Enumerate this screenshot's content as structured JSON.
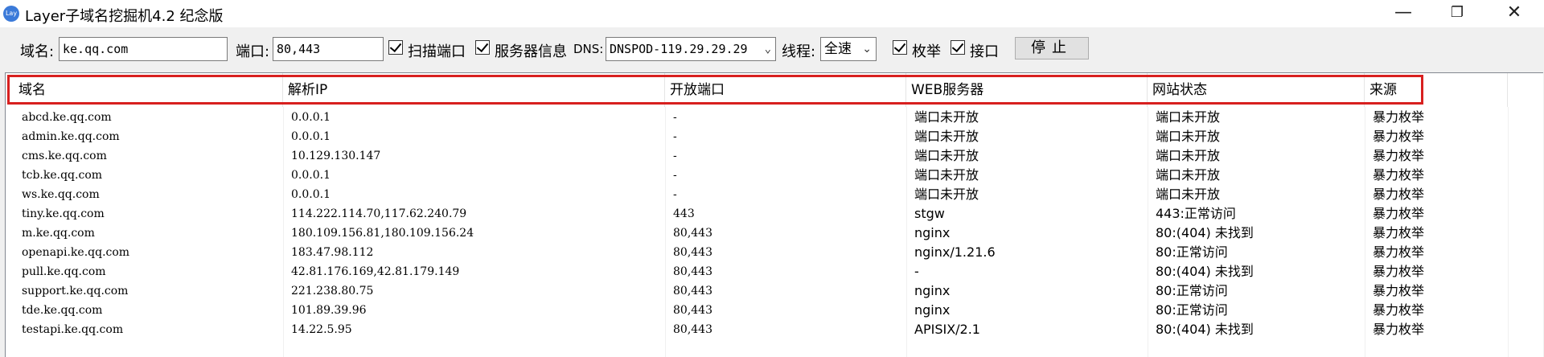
{
  "window": {
    "icon_text": "Lay",
    "title": "Layer子域名挖掘机4.2 纪念版",
    "minimize": "—",
    "restore": "❐",
    "close": "✕"
  },
  "toolbar": {
    "domain_label": "域名:",
    "domain_value": "ke.qq.com",
    "port_label": "端口:",
    "port_value": "80,443",
    "scan_ports_label": "扫描端口",
    "scan_ports_checked": true,
    "server_info_label": "服务器信息",
    "server_info_checked": true,
    "dns_label": "DNS:",
    "dns_value": "DNSPOD-119.29.29.29",
    "threads_label": "线程:",
    "threads_value": "全速",
    "brute_label": "枚举",
    "brute_checked": true,
    "api_label": "接口",
    "api_checked": true,
    "stop_button": "停止"
  },
  "table": {
    "columns": [
      "域名",
      "解析IP",
      "开放端口",
      "WEB服务器",
      "网站状态",
      "来源"
    ],
    "rows": [
      [
        "abcd.ke.qq.com",
        "0.0.0.1",
        "-",
        "端口未开放",
        "端口未开放",
        "暴力枚举"
      ],
      [
        "admin.ke.qq.com",
        "0.0.0.1",
        "-",
        "端口未开放",
        "端口未开放",
        "暴力枚举"
      ],
      [
        "cms.ke.qq.com",
        "10.129.130.147",
        "-",
        "端口未开放",
        "端口未开放",
        "暴力枚举"
      ],
      [
        "tcb.ke.qq.com",
        "0.0.0.1",
        "-",
        "端口未开放",
        "端口未开放",
        "暴力枚举"
      ],
      [
        "ws.ke.qq.com",
        "0.0.0.1",
        "-",
        "端口未开放",
        "端口未开放",
        "暴力枚举"
      ],
      [
        "tiny.ke.qq.com",
        "114.222.114.70,117.62.240.79",
        "443",
        "stgw",
        "443:正常访问",
        "暴力枚举"
      ],
      [
        "m.ke.qq.com",
        "180.109.156.81,180.109.156.24",
        "80,443",
        "nginx",
        "80:(404) 未找到",
        "暴力枚举"
      ],
      [
        "openapi.ke.qq.com",
        "183.47.98.112",
        "80,443",
        "nginx/1.21.6",
        "80:正常访问",
        "暴力枚举"
      ],
      [
        "pull.ke.qq.com",
        "42.81.176.169,42.81.179.149",
        "80,443",
        "-",
        "80:(404) 未找到",
        "暴力枚举"
      ],
      [
        "support.ke.qq.com",
        "221.238.80.75",
        "80,443",
        "nginx",
        "80:正常访问",
        "暴力枚举"
      ],
      [
        "tde.ke.qq.com",
        "101.89.39.96",
        "80,443",
        "nginx",
        "80:正常访问",
        "暴力枚举"
      ],
      [
        "testapi.ke.qq.com",
        "14.22.5.95",
        "80,443",
        "APISIX/2.1",
        "80:(404) 未找到",
        "暴力枚举"
      ]
    ]
  },
  "colors": {
    "highlight": "#d8201f",
    "app_icon": "#3b7ad9"
  }
}
